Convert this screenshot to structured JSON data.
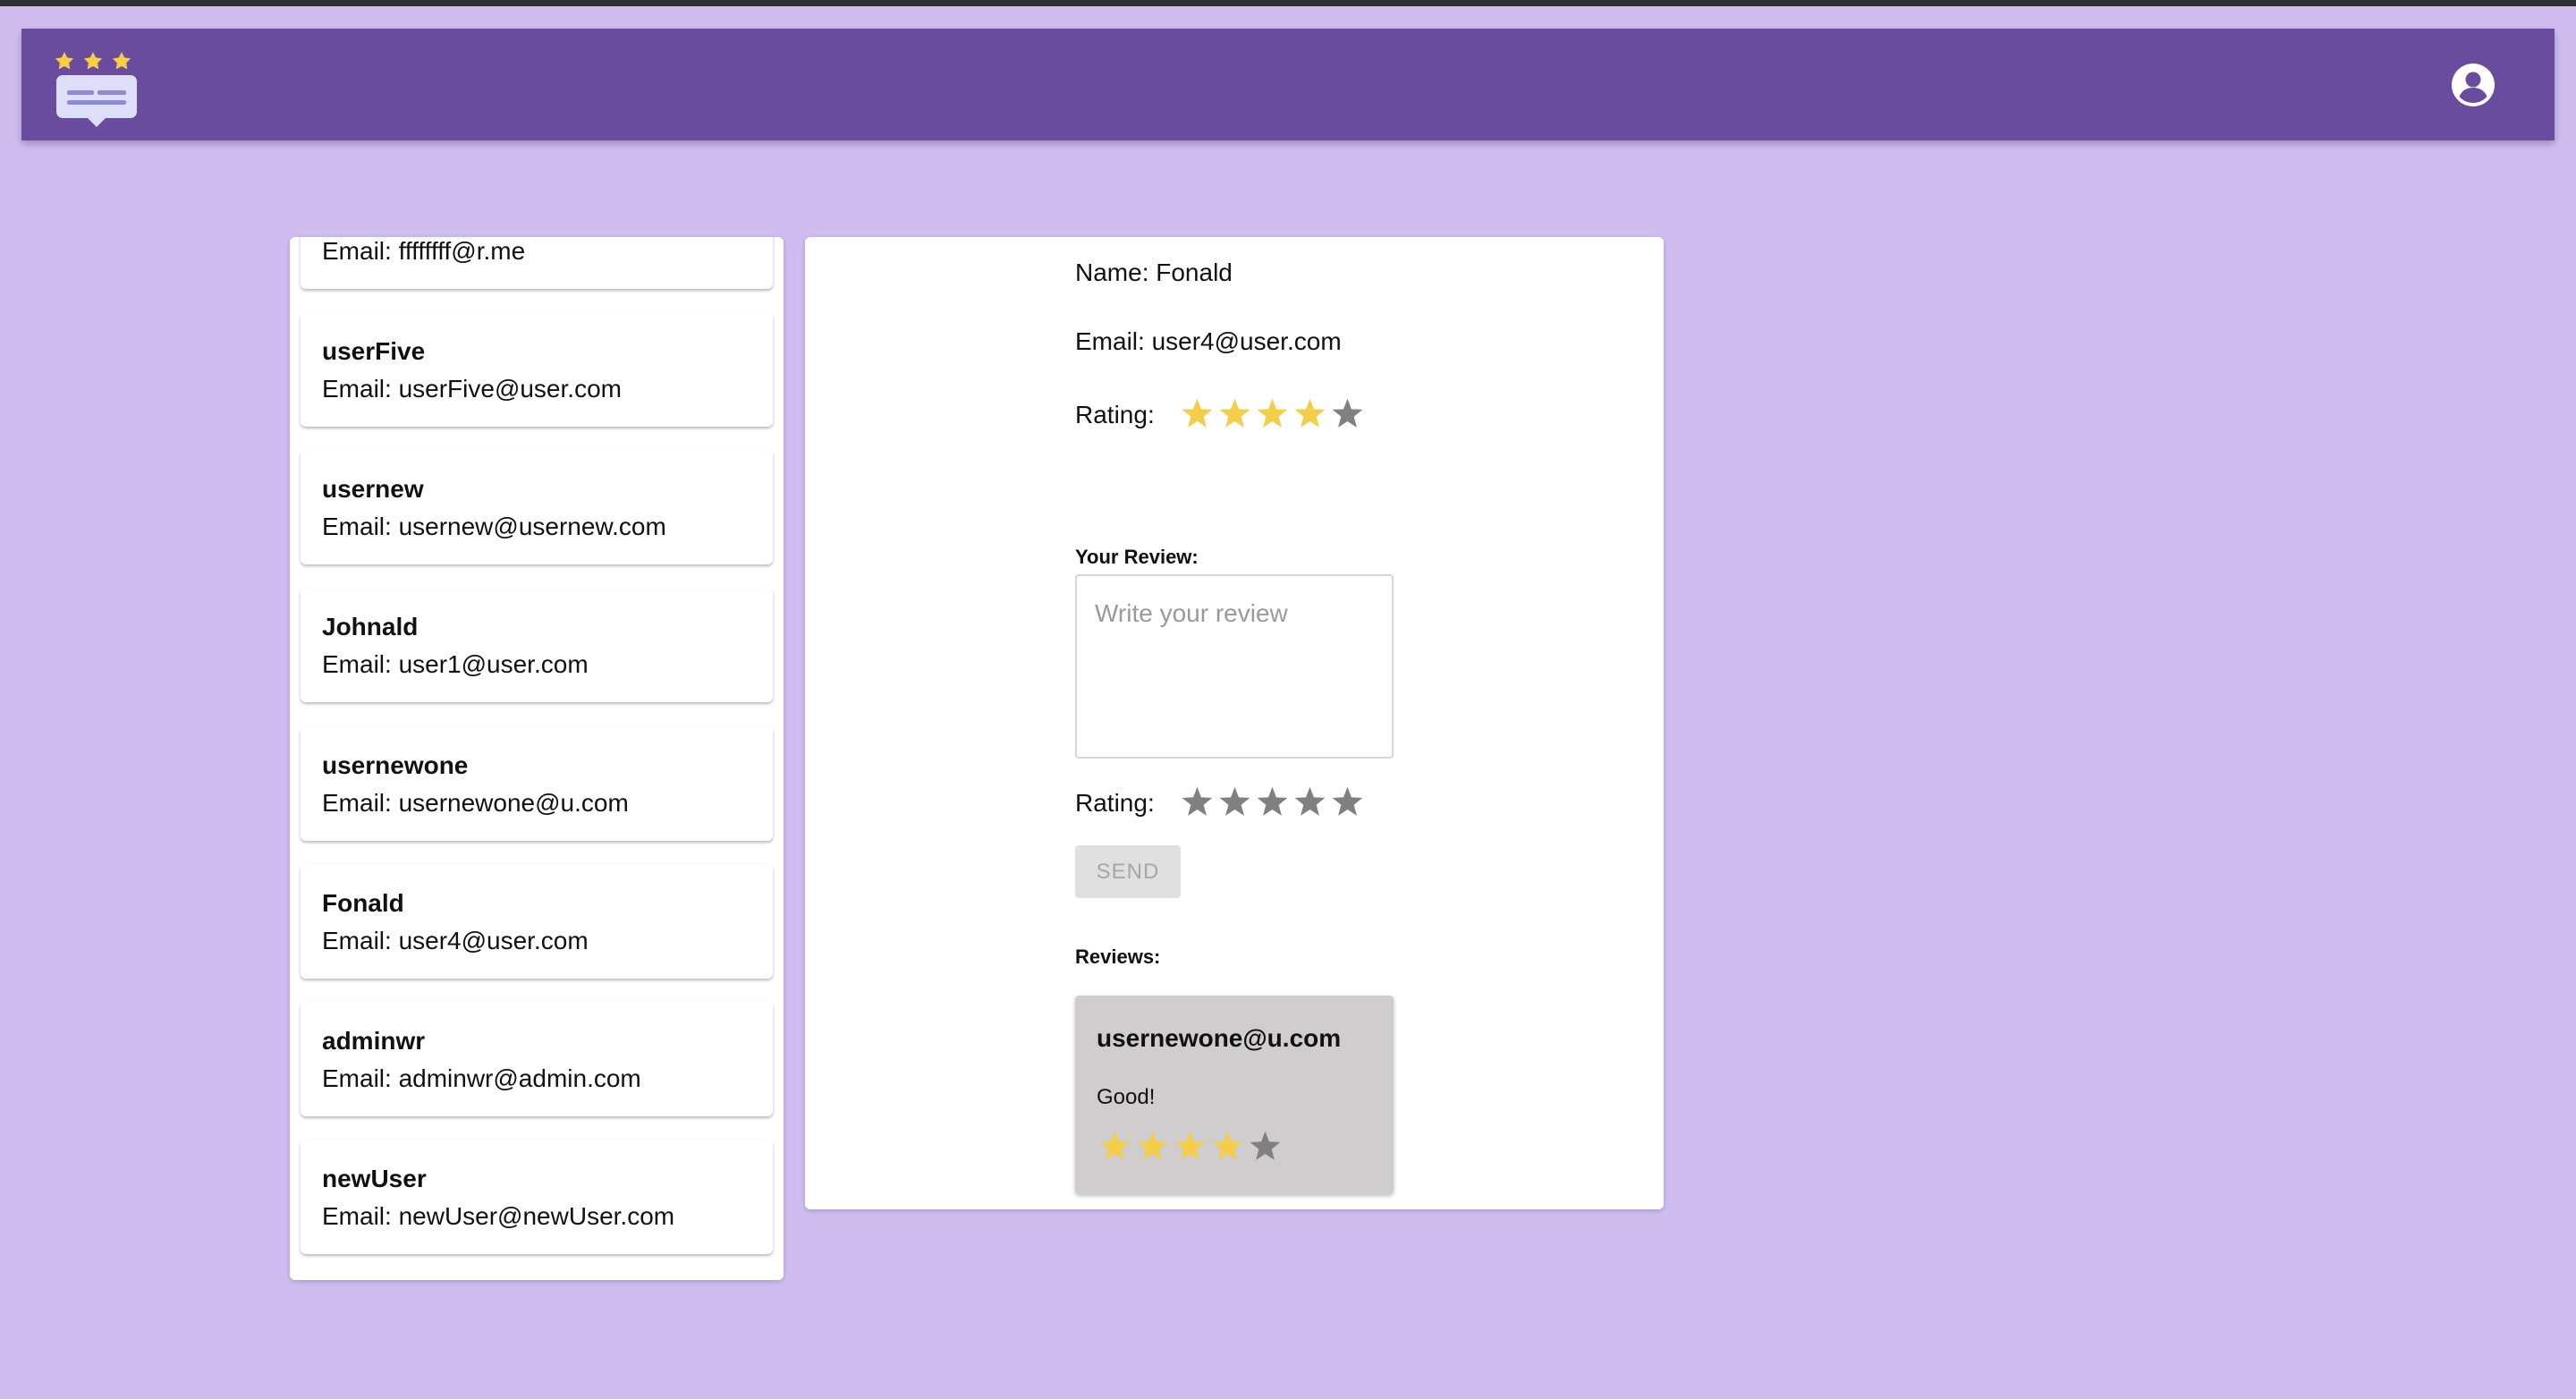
{
  "app": {
    "logo_icon": "review-stars-chat-logo",
    "account_icon": "account-circle-icon"
  },
  "colors": {
    "page_background": "#cfbdf0",
    "appbar": "#6a4c9f",
    "star_filled": "#f4ce48",
    "star_empty": "#808080"
  },
  "users": [
    {
      "name": "",
      "email": "Email: ffffffff@r.me"
    },
    {
      "name": "userFive",
      "email": "Email: userFive@user.com"
    },
    {
      "name": "usernew",
      "email": "Email: usernew@usernew.com"
    },
    {
      "name": "Johnald",
      "email": "Email: user1@user.com"
    },
    {
      "name": "usernewone",
      "email": "Email: usernewone@u.com"
    },
    {
      "name": "Fonald",
      "email": "Email: user4@user.com"
    },
    {
      "name": "adminwr",
      "email": "Email: adminwr@admin.com"
    },
    {
      "name": "newUser",
      "email": "Email: newUser@newUser.com"
    }
  ],
  "detail": {
    "name": "Name: Fonald",
    "email": "Email: user4@user.com",
    "rating_label": "Rating:",
    "rating": 4,
    "max_rating": 5
  },
  "review_form": {
    "label": "Your Review:",
    "placeholder": "Write your review",
    "value": "",
    "rating_label": "Rating:",
    "rating": 0,
    "send_label": "SEND"
  },
  "reviews_section": {
    "label": "Reviews:",
    "items": [
      {
        "author": "usernewone@u.com",
        "text": "Good!",
        "rating": 4
      }
    ]
  }
}
